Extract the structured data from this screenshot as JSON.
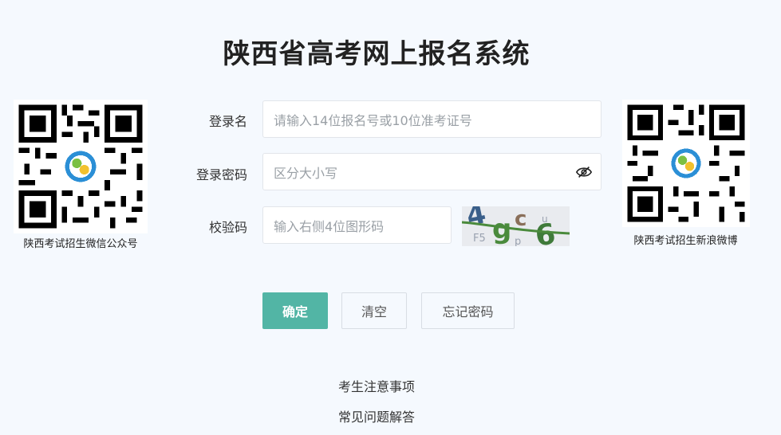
{
  "page": {
    "title": "陕西省高考网上报名系统"
  },
  "qr_left": {
    "caption": "陕西考试招生微信公众号"
  },
  "qr_right": {
    "caption": "陕西考试招生新浪微博"
  },
  "form": {
    "username": {
      "label": "登录名",
      "placeholder": "请输入14位报名号或10位准考证号"
    },
    "password": {
      "label": "登录密码",
      "placeholder": "区分大小写"
    },
    "captcha": {
      "label": "校验码",
      "placeholder": "输入右侧4位图形码",
      "image_text": "4gc6"
    }
  },
  "buttons": {
    "confirm": "确定",
    "clear": "清空",
    "forgot": "忘记密码"
  },
  "links": {
    "notice": "考生注意事项",
    "faq": "常见问题解答"
  },
  "colors": {
    "background": "#f5f9fe",
    "primary": "#52b5a5"
  }
}
